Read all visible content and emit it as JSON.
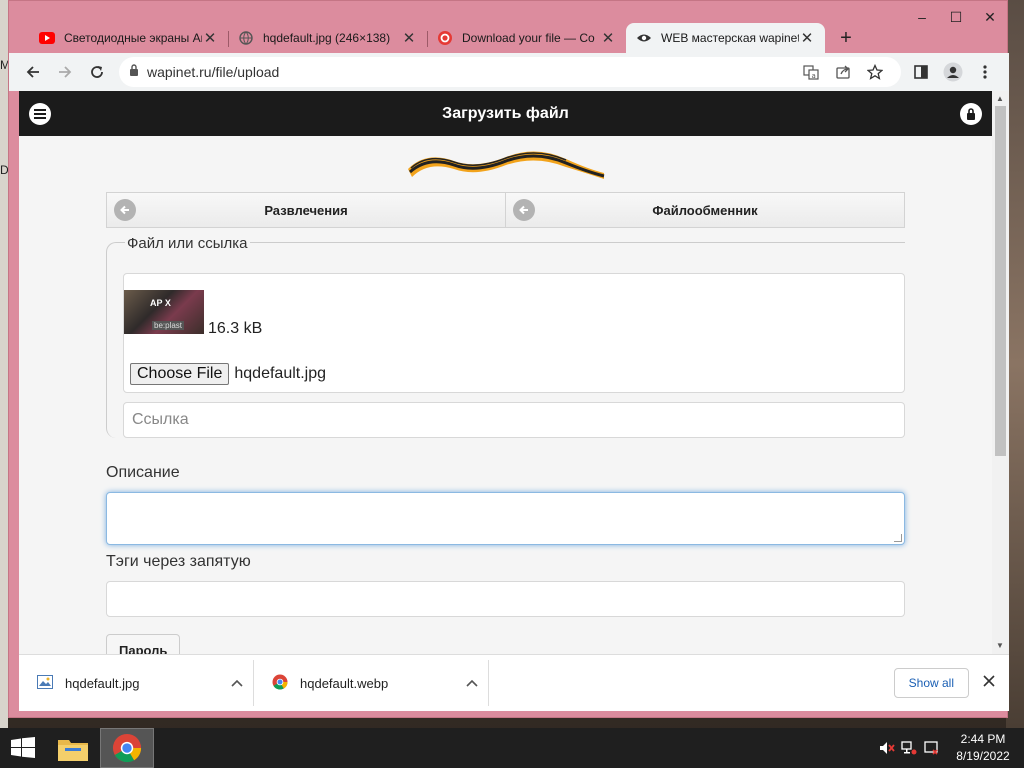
{
  "window": {
    "minimize": "–",
    "maximize": "☐",
    "close": "✕"
  },
  "tabs": [
    {
      "title": "Светодиодные экраны Ан",
      "icon": "youtube-icon",
      "active": false
    },
    {
      "title": "hqdefault.jpg (246×138)",
      "icon": "globe-icon",
      "active": false
    },
    {
      "title": "Download your file — Co",
      "icon": "convertio-icon",
      "active": false
    },
    {
      "title": "WEB мастерская wapinet",
      "icon": "wapinet-eye-icon",
      "active": true
    }
  ],
  "tab_close": "✕",
  "new_tab": "+",
  "address": {
    "url": "wapinet.ru/file/upload"
  },
  "header": {
    "title": "Загрузить файл"
  },
  "breadcrumbs": [
    "Развлечения",
    "Файлообменник"
  ],
  "form": {
    "file_legend": "Файл или ссылка",
    "thumb_text_top": "AP X",
    "thumb_text_bottom": "be:plast",
    "file_size": "16.3 kB",
    "choose_label": "Choose File",
    "chosen_file": "hqdefault.jpg",
    "link_placeholder": "Ссылка",
    "description_label": "Описание",
    "tags_label": "Тэги через запятую",
    "password_label": "Пароль"
  },
  "downloads": {
    "items": [
      {
        "name": "hqdefault.jpg",
        "icon": "image-file-icon"
      },
      {
        "name": "hqdefault.webp",
        "icon": "chrome-file-icon"
      }
    ],
    "show_all": "Show all"
  },
  "taskbar": {
    "time": "2:44 PM",
    "date": "8/19/2022"
  },
  "desktop_fragments": [
    "M",
    "D"
  ]
}
